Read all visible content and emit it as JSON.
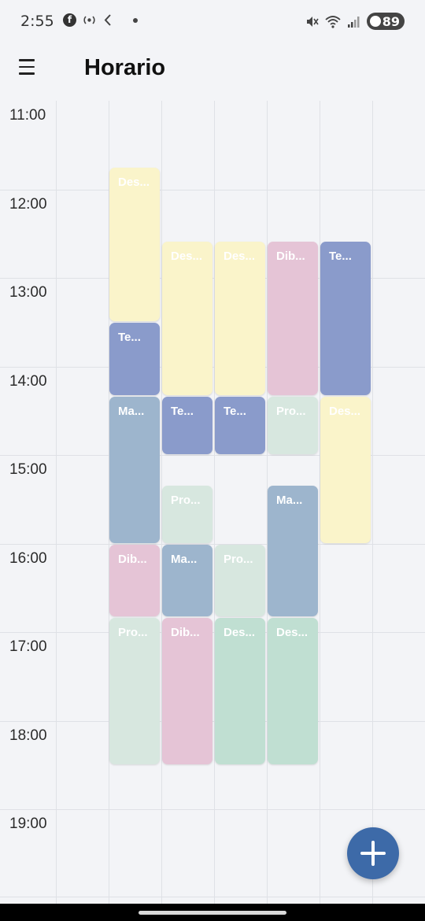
{
  "status_bar": {
    "time": "2:55",
    "left_icons": [
      "facebook-icon",
      "location-radar-icon",
      "download-icon",
      "notification-dot-icon"
    ],
    "right_icons": [
      "mute-icon",
      "wifi-icon",
      "signal-icon"
    ],
    "battery": "89"
  },
  "header": {
    "menu_icon": "hamburger-menu-icon",
    "title": "Horario"
  },
  "schedule": {
    "hours": [
      "11:00",
      "12:00",
      "13:00",
      "14:00",
      "15:00",
      "16:00",
      "17:00",
      "18:00",
      "19:00"
    ],
    "colors": {
      "yellow": "#faf4ca",
      "indigo": "#8a9bcb",
      "steel": "#9db5cd",
      "pink": "#e5c4d6",
      "mint": "#d7e7df",
      "seafoam": "#c0dfd2"
    },
    "events": [
      {
        "label": "Des...",
        "col": 1,
        "start": "11:45",
        "end": "13:30",
        "color": "yellow"
      },
      {
        "label": "Te...",
        "col": 1,
        "start": "13:30",
        "end": "14:20",
        "color": "indigo"
      },
      {
        "label": "Ma...",
        "col": 1,
        "start": "14:20",
        "end": "16:00",
        "color": "steel"
      },
      {
        "label": "Dib...",
        "col": 1,
        "start": "16:00",
        "end": "16:50",
        "color": "pink"
      },
      {
        "label": "Pro...",
        "col": 1,
        "start": "16:50",
        "end": "18:30",
        "color": "mint"
      },
      {
        "label": "Des...",
        "col": 2,
        "start": "12:35",
        "end": "14:20",
        "color": "yellow"
      },
      {
        "label": "Te...",
        "col": 2,
        "start": "14:20",
        "end": "15:00",
        "color": "indigo"
      },
      {
        "label": "Pro...",
        "col": 2,
        "start": "15:20",
        "end": "16:00",
        "color": "mint"
      },
      {
        "label": "Ma...",
        "col": 2,
        "start": "16:00",
        "end": "16:50",
        "color": "steel"
      },
      {
        "label": "Dib...",
        "col": 2,
        "start": "16:50",
        "end": "18:30",
        "color": "pink"
      },
      {
        "label": "Des...",
        "col": 3,
        "start": "12:35",
        "end": "14:20",
        "color": "yellow"
      },
      {
        "label": "Te...",
        "col": 3,
        "start": "14:20",
        "end": "15:00",
        "color": "indigo"
      },
      {
        "label": "Pro...",
        "col": 3,
        "start": "16:00",
        "end": "16:50",
        "color": "mint"
      },
      {
        "label": "Des...",
        "col": 3,
        "start": "16:50",
        "end": "18:30",
        "color": "seafoam"
      },
      {
        "label": "Dib...",
        "col": 4,
        "start": "12:35",
        "end": "14:20",
        "color": "pink"
      },
      {
        "label": "Pro...",
        "col": 4,
        "start": "14:20",
        "end": "15:00",
        "color": "mint"
      },
      {
        "label": "Ma...",
        "col": 4,
        "start": "15:20",
        "end": "16:50",
        "color": "steel"
      },
      {
        "label": "Des...",
        "col": 4,
        "start": "16:50",
        "end": "18:30",
        "color": "seafoam"
      },
      {
        "label": "Te...",
        "col": 5,
        "start": "12:35",
        "end": "14:20",
        "color": "indigo"
      },
      {
        "label": "Des...",
        "col": 5,
        "start": "14:20",
        "end": "16:00",
        "color": "yellow"
      }
    ]
  },
  "fab": {
    "icon": "plus-icon",
    "color": "#3d6aa8"
  }
}
